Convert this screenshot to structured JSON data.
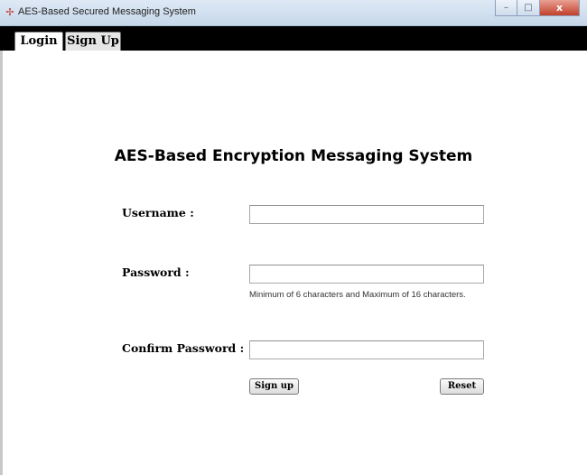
{
  "window": {
    "title": "AES-Based Secured Messaging System",
    "app_icon": "app-icon",
    "controls": {
      "minimize": "–",
      "maximize": "□",
      "close": "x"
    }
  },
  "tabs": [
    {
      "label": "Login",
      "selected": false
    },
    {
      "label": "Sign Up",
      "selected": true
    }
  ],
  "form": {
    "heading": "AES-Based Encryption Messaging System",
    "username": {
      "label": "Username :",
      "value": ""
    },
    "password": {
      "label": "Password :",
      "value": "",
      "hint": "Minimum of 6 characters and Maximum of 16 characters."
    },
    "confirm_password": {
      "label": "Confirm Password :",
      "value": ""
    },
    "signup_button": "Sign up",
    "reset_button": "Reset"
  },
  "colors": {
    "tab_bar": "#000000",
    "titlebar": "#c6d7ea",
    "close_button": "#c2412b"
  }
}
